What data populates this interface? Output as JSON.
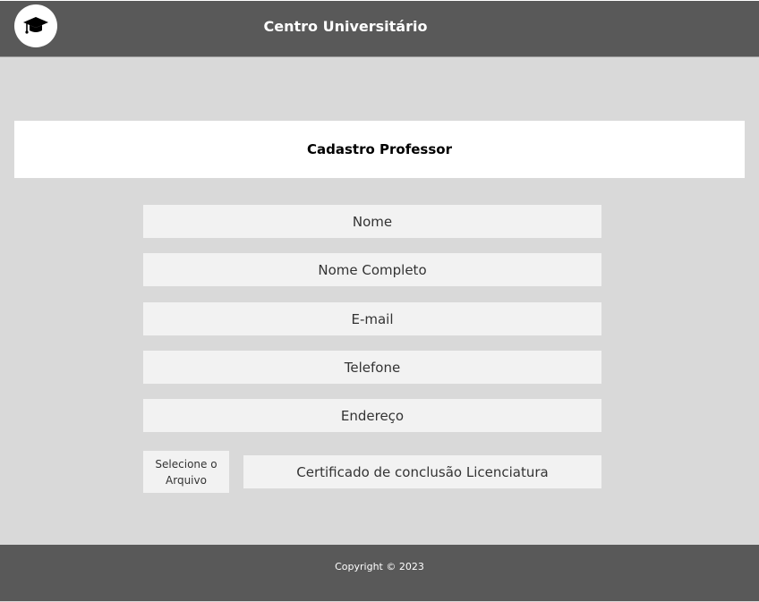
{
  "header": {
    "title": "Centro Universitário",
    "logo_icon": "graduation-cap-icon"
  },
  "card": {
    "title": "Cadastro Professor"
  },
  "form": {
    "nome_placeholder": "Nome",
    "nome_completo_placeholder": "Nome Completo",
    "email_placeholder": "E-mail",
    "telefone_placeholder": "Telefone",
    "endereco_placeholder": "Endereço",
    "file_button_label": "Selecione o Arquivo",
    "certificado_placeholder": "Certificado de conclusão Licenciatura"
  },
  "footer": {
    "copyright": "Copyright © 2023"
  },
  "colors": {
    "header_bg": "#595959",
    "page_bg": "#d9d9d9",
    "field_bg": "#f2f2f2",
    "card_bg": "#ffffff"
  }
}
